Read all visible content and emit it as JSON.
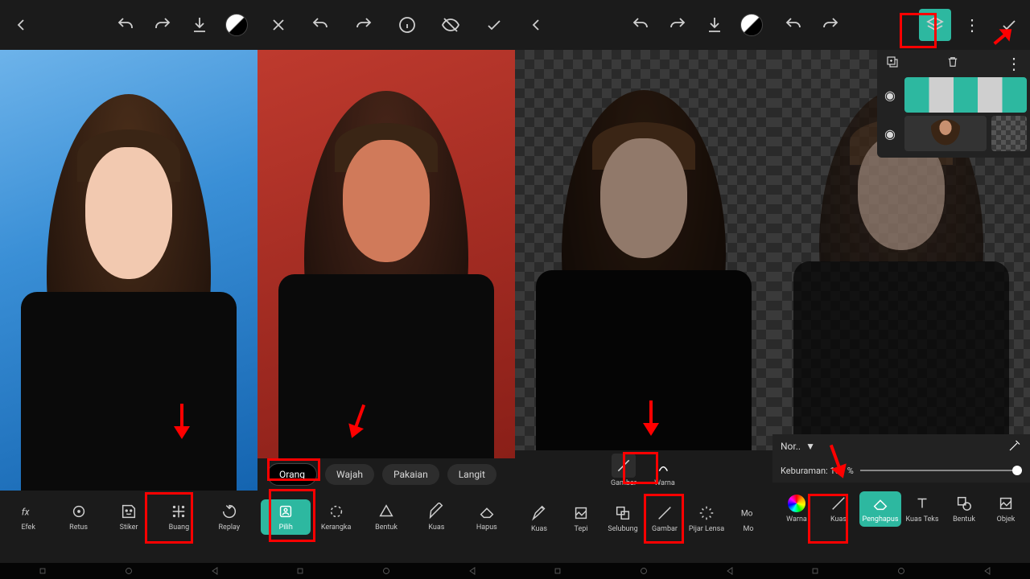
{
  "panel1": {
    "tools": [
      {
        "id": "efek",
        "label": "Efek"
      },
      {
        "id": "retus",
        "label": "Retus"
      },
      {
        "id": "stiker",
        "label": "Stiker"
      },
      {
        "id": "buang",
        "label": "Buang"
      },
      {
        "id": "replay",
        "label": "Replay"
      }
    ]
  },
  "panel2": {
    "chips": [
      {
        "id": "orang",
        "label": "Orang",
        "active": true
      },
      {
        "id": "wajah",
        "label": "Wajah"
      },
      {
        "id": "pakaian",
        "label": "Pakaian"
      },
      {
        "id": "langit",
        "label": "Langit"
      }
    ],
    "tools": [
      {
        "id": "pilih",
        "label": "Pilih",
        "selected": true
      },
      {
        "id": "kerangka",
        "label": "Kerangka"
      },
      {
        "id": "bentuk",
        "label": "Bentuk"
      },
      {
        "id": "kuas",
        "label": "Kuas"
      },
      {
        "id": "hapus",
        "label": "Hapus"
      }
    ]
  },
  "panel3": {
    "mini": [
      {
        "id": "gambar",
        "label": "Gambar",
        "hl": true
      },
      {
        "id": "warna",
        "label": "Warna"
      }
    ],
    "tools": [
      {
        "id": "kuas",
        "label": "Kuas"
      },
      {
        "id": "tepi",
        "label": "Tepi"
      },
      {
        "id": "selubung",
        "label": "Selubung"
      },
      {
        "id": "gambar",
        "label": "Gambar",
        "hl": true
      },
      {
        "id": "pijar",
        "label": "Pijar Lensa"
      },
      {
        "id": "mov",
        "label": "Mo"
      }
    ]
  },
  "panel4": {
    "blend_label": "Nor..",
    "opacity_label": "Keburaman:",
    "opacity_value": "100 %",
    "tools": [
      {
        "id": "warna",
        "label": "Warna"
      },
      {
        "id": "kuas",
        "label": "Kuas",
        "hl": true
      },
      {
        "id": "penghapus",
        "label": "Penghapus",
        "selected": true
      },
      {
        "id": "kuasteks",
        "label": "Kuas Teks"
      },
      {
        "id": "bentuk",
        "label": "Bentuk"
      },
      {
        "id": "objek",
        "label": "Objek"
      }
    ]
  }
}
